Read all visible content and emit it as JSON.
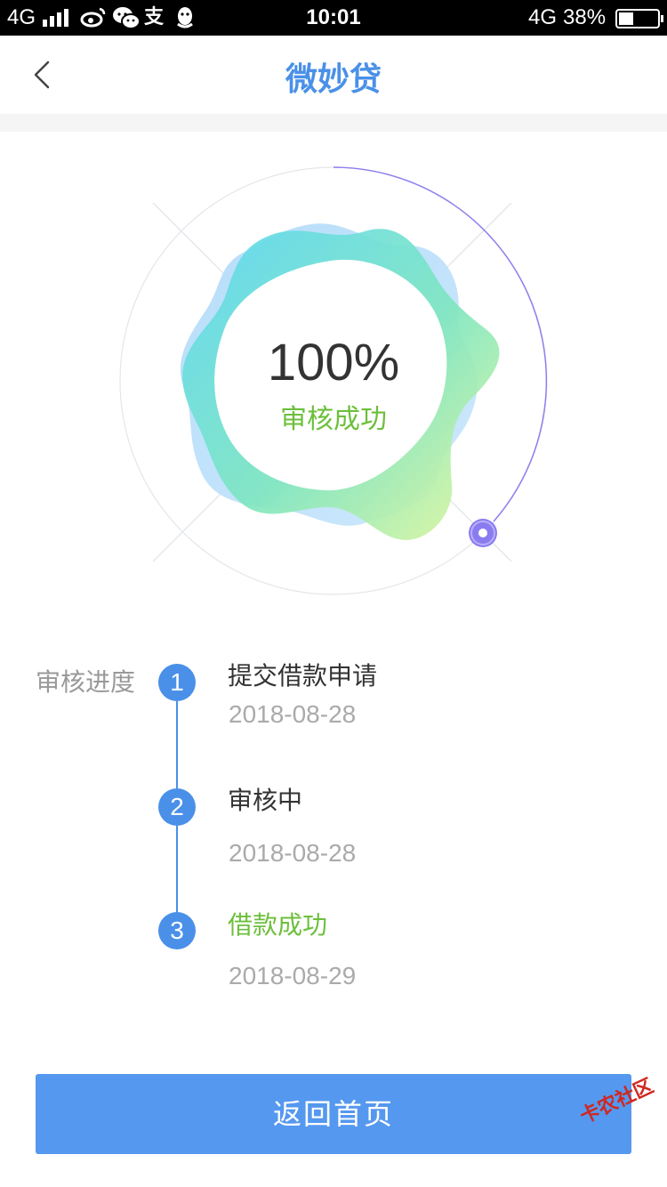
{
  "status_bar": {
    "network_left": "4G",
    "time": "10:01",
    "network_right": "4G",
    "battery_percent": "38%",
    "battery_level": 0.38,
    "app_icons": [
      "weibo-icon",
      "wechat-icon",
      "alipay-icon",
      "qq-icon"
    ]
  },
  "header": {
    "title": "微妙贷",
    "back_icon": "chevron-left-icon"
  },
  "hero": {
    "percent": "100%",
    "status": "审核成功",
    "progress": 1.0
  },
  "progress": {
    "label": "审核进度",
    "steps": [
      {
        "number": "1",
        "title": "提交借款申请",
        "date": "2018-08-28",
        "status": "done"
      },
      {
        "number": "2",
        "title": "审核中",
        "date": "2018-08-28",
        "status": "done"
      },
      {
        "number": "3",
        "title": "借款成功",
        "date": "2018-08-29",
        "status": "success"
      }
    ]
  },
  "button": {
    "label": "返回首页"
  },
  "watermark": {
    "text": "卡农社区"
  },
  "colors": {
    "accent": "#4a90e8",
    "button": "#5598ef",
    "success": "#6dbf3c",
    "ring": "#8a7cf0"
  }
}
